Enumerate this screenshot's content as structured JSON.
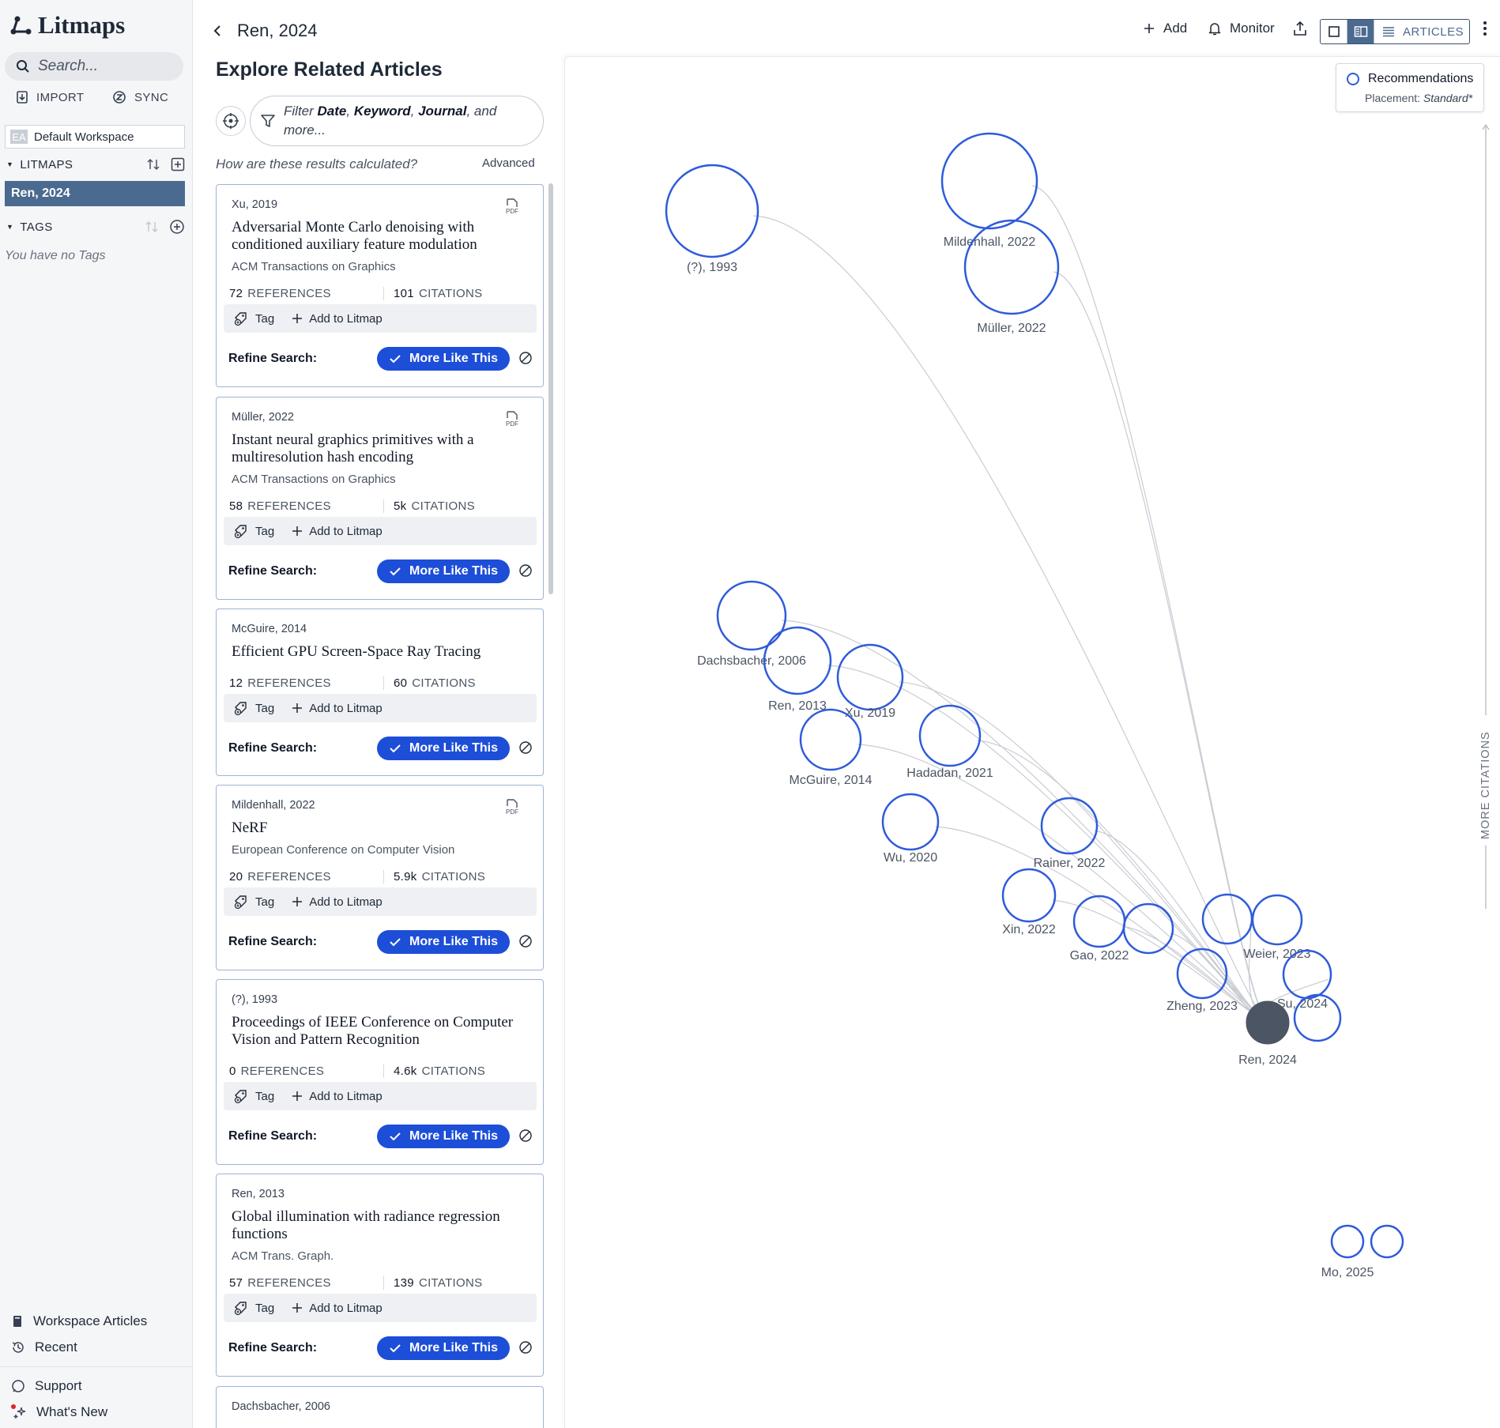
{
  "app": {
    "name": "Litmaps",
    "search_placeholder": "Search..."
  },
  "sidebar": {
    "import_label": "IMPORT",
    "sync_label": "SYNC",
    "workspace_badge": "EA",
    "workspace_name": "Default Workspace",
    "litmaps_label": "LITMAPS",
    "active_map": "Ren, 2024",
    "tags_label": "TAGS",
    "no_tags": "You have no Tags",
    "workspace_articles": "Workspace Articles",
    "recent": "Recent",
    "support": "Support",
    "whats_new": "What's New"
  },
  "header": {
    "map_title": "Ren, 2024",
    "add": "Add",
    "monitor": "Monitor",
    "articles": "ARTICLES"
  },
  "explore": {
    "title": "Explore Related Articles",
    "filter_prefix": "Filter ",
    "filter_date": "Date",
    "filter_keyword": "Keyword",
    "filter_journal": "Journal",
    "filter_suffix": " and more...",
    "how_calculated": "How are these results calculated?",
    "advanced": "Advanced"
  },
  "card_labels": {
    "references": "REFERENCES",
    "citations": "CITATIONS",
    "tag": "Tag",
    "add_to_litmap": "Add to Litmap",
    "refine": "Refine Search:",
    "more_like_this": "More Like This",
    "pdf": "PDF"
  },
  "cards": [
    {
      "author": "Xu, 2019",
      "title": "Adversarial Monte Carlo denoising with conditioned auxiliary feature modulation",
      "journal": "ACM Transactions on Graphics",
      "refs": "72",
      "cites": "101"
    },
    {
      "author": "Müller, 2022",
      "title": "Instant neural graphics primitives with a multiresolution hash encoding",
      "journal": "ACM Transactions on Graphics",
      "refs": "58",
      "cites": "5k"
    },
    {
      "author": "McGuire, 2014",
      "title": "Efficient GPU Screen-Space Ray Tracing",
      "journal": "",
      "refs": "12",
      "cites": "60"
    },
    {
      "author": "Mildenhall, 2022",
      "title": "NeRF",
      "journal": "European Conference on Computer Vision",
      "refs": "20",
      "cites": "5.9k"
    },
    {
      "author": "(?), 1993",
      "title": "Proceedings of IEEE Conference on Computer Vision and Pattern Recognition",
      "journal": "",
      "refs": "0",
      "cites": "4.6k"
    },
    {
      "author": "Ren, 2013",
      "title": "Global illumination with radiance regression functions",
      "journal": "ACM Trans. Graph.",
      "refs": "57",
      "cites": "139"
    },
    {
      "author": "Dachsbacher, 2006",
      "title": "",
      "journal": "",
      "refs": "",
      "cites": ""
    }
  ],
  "map": {
    "legend_title": "Recommendations",
    "legend_placement_label": "Placement:",
    "legend_placement_value": "Standard*",
    "y_axis_label": "MORE CITATIONS",
    "accent_color": "#2f5bdb",
    "target_color": "#4b5563",
    "nodes": [
      {
        "label": "(?), 1993"
      },
      {
        "label": "Mildenhall, 2022"
      },
      {
        "label": "Müller, 2022"
      },
      {
        "label": "Dachsbacher, 2006"
      },
      {
        "label": "Ren, 2013"
      },
      {
        "label": "Xu, 2019"
      },
      {
        "label": "McGuire, 2014"
      },
      {
        "label": "Hadadan, 2021"
      },
      {
        "label": "Wu, 2020"
      },
      {
        "label": "Rainer, 2022"
      },
      {
        "label": "Xin, 2022"
      },
      {
        "label": "Gao, 2022"
      },
      {
        "label": ""
      },
      {
        "label": ""
      },
      {
        "label": "Weier, 2023"
      },
      {
        "label": "Zheng, 2023"
      },
      {
        "label": "Su, 2024"
      },
      {
        "label": ""
      },
      {
        "label": "Ren, 2024"
      },
      {
        "label": "Mo, 2025"
      },
      {
        "label": ""
      }
    ]
  }
}
